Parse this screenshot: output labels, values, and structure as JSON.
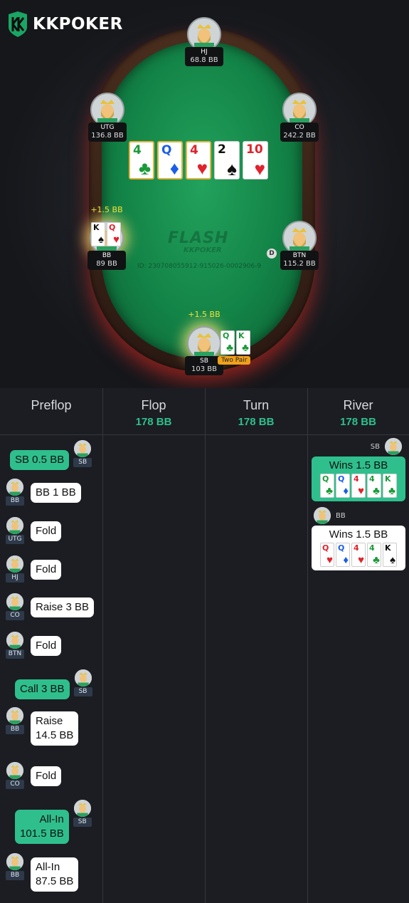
{
  "app": {
    "logo_text": "KKPOKER",
    "brand_watermark": "FLASH",
    "brand_sub": "KKPOKER",
    "hand_id": "ID: 230708055912-915026-0002906-9",
    "dealer": "D"
  },
  "seats": {
    "hj": {
      "name": "HJ",
      "stack": "68.8 BB"
    },
    "utg": {
      "name": "UTG",
      "stack": "136.8 BB"
    },
    "co": {
      "name": "CO",
      "stack": "242.2 BB"
    },
    "bb": {
      "name": "BB",
      "stack": "89 BB",
      "gain": "+1.5 BB"
    },
    "btn": {
      "name": "BTN",
      "stack": "115.2 BB"
    },
    "sb": {
      "name": "SB",
      "stack": "103 BB",
      "gain": "+1.5 BB",
      "hand_label": "Two Pair"
    }
  },
  "board": [
    {
      "rank": "4",
      "suit": "♣",
      "color": "grn"
    },
    {
      "rank": "Q",
      "suit": "♦",
      "color": "blu"
    },
    {
      "rank": "4",
      "suit": "♥",
      "color": "red"
    },
    {
      "rank": "2",
      "suit": "♠",
      "color": "blk"
    },
    {
      "rank": "10",
      "suit": "♥",
      "color": "red"
    }
  ],
  "bb_hole": [
    {
      "rank": "K",
      "suit": "♠",
      "color": "blk"
    },
    {
      "rank": "Q",
      "suit": "♥",
      "color": "red"
    }
  ],
  "sb_hole": [
    {
      "rank": "Q",
      "suit": "♣",
      "color": "grn"
    },
    {
      "rank": "K",
      "suit": "♣",
      "color": "grn"
    }
  ],
  "streets": [
    {
      "name": "Preflop",
      "pot": ""
    },
    {
      "name": "Flop",
      "pot": "178 BB"
    },
    {
      "name": "Turn",
      "pot": "178 BB"
    },
    {
      "name": "River",
      "pot": "178 BB"
    }
  ],
  "preflop_actions": [
    {
      "pos": "SB",
      "text": "SB 0.5 BB",
      "side": "right"
    },
    {
      "pos": "BB",
      "text": "BB 1 BB",
      "side": "left"
    },
    {
      "pos": "UTG",
      "text": "Fold",
      "side": "left"
    },
    {
      "pos": "HJ",
      "text": "Fold",
      "side": "left"
    },
    {
      "pos": "CO",
      "text": "Raise 3 BB",
      "side": "left"
    },
    {
      "pos": "BTN",
      "text": "Fold",
      "side": "left"
    },
    {
      "pos": "SB",
      "text": "Call 3 BB",
      "side": "right"
    },
    {
      "pos": "BB",
      "text_line1": "Raise",
      "text_line2": "14.5 BB",
      "side": "left"
    },
    {
      "pos": "CO",
      "text": "Fold",
      "side": "left"
    },
    {
      "pos": "SB",
      "text_line1": "All-In",
      "text_line2": "101.5 BB",
      "side": "right"
    },
    {
      "pos": "BB",
      "text_line1": "All-In",
      "text_line2": "87.5 BB",
      "side": "left"
    }
  ],
  "river": {
    "sb": {
      "name": "SB",
      "label": "Wins 1.5 BB"
    },
    "bb": {
      "name": "BB",
      "label": "Wins 1.5 BB"
    }
  }
}
